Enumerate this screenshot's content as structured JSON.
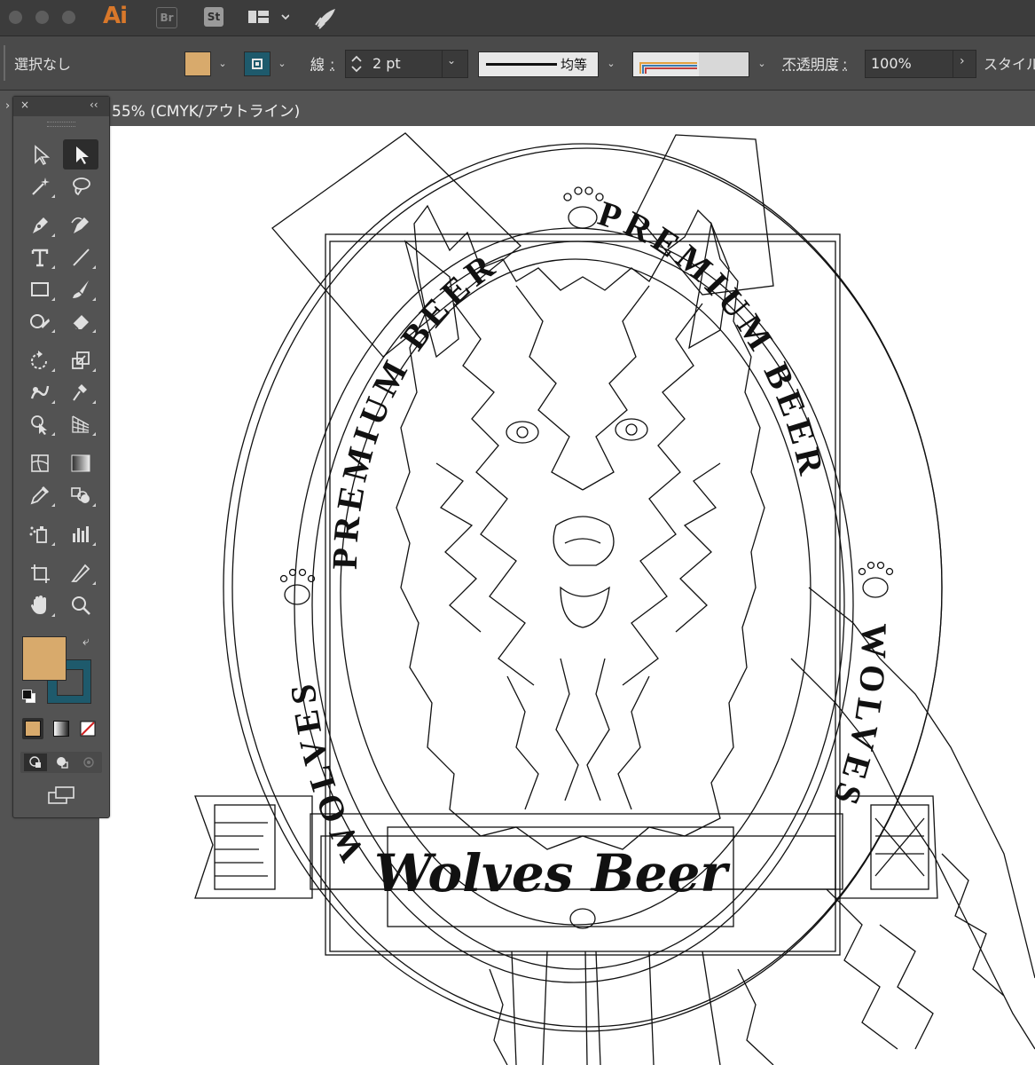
{
  "app": {
    "logo": "Ai",
    "bridge": "Br",
    "stock": "St"
  },
  "control": {
    "selection": "選択なし",
    "stroke_label": "線",
    "stroke_colon": ":",
    "stroke_weight": "2 pt",
    "profile_label": "均等",
    "opacity_label": "不透明度",
    "opacity_colon": ":",
    "opacity_value": "100%",
    "style_label": "スタイル"
  },
  "document": {
    "tab_title": "55% (CMYK/アウトライン)"
  },
  "colors": {
    "fill": "#d8aa6c",
    "stroke": "#1e5a6c"
  },
  "artwork": {
    "arc_top_left": "PREMIUM BEER",
    "arc_top_right": "PREMIUM BEER",
    "arc_left": "PREMIUM BEER",
    "arc_right": "PREMIUM BEER",
    "side_left": "WOLVES",
    "side_right": "WOLVES",
    "banner": "Wolves Beer"
  },
  "icons": {
    "left_top": [
      "selection-tool-icon",
      "direct-selection-tool-icon"
    ],
    "tools": [
      "magic-wand-icon",
      "lasso-icon",
      "pen-icon",
      "curvature-icon",
      "type-icon",
      "line-icon",
      "rectangle-icon",
      "paintbrush-icon",
      "shaper-icon",
      "eraser-icon",
      "rotate-icon",
      "scale-icon",
      "warp-icon",
      "puppet-warp-icon",
      "shape-builder-icon",
      "perspective-grid-icon",
      "mesh-icon",
      "gradient-icon",
      "eyedropper-icon",
      "blend-icon",
      "symbol-sprayer-icon",
      "graph-icon",
      "artboard-icon",
      "slice-icon",
      "hand-icon",
      "zoom-icon"
    ]
  }
}
